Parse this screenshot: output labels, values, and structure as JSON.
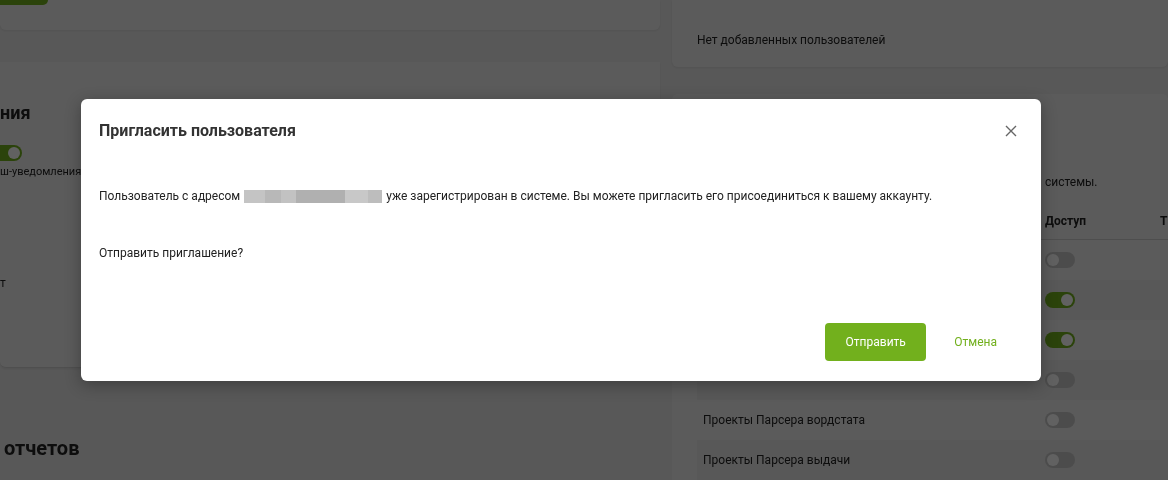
{
  "background": {
    "left_panel": {
      "section_heading": "ния",
      "toggle": {
        "on": true
      },
      "option_label": "ш-уведомления",
      "option_label_2": "т",
      "reports_heading": "отчетов"
    },
    "users_card": {
      "empty_text": "Нет добавленных пользователей"
    },
    "access_card": {
      "description": "системы.",
      "columns": [
        "Доступ",
        "Т"
      ],
      "rows": [
        {
          "on": false
        },
        {
          "on": true
        },
        {
          "on": true
        },
        {
          "on": false
        },
        {
          "label": "Проекты Парсера вордстата",
          "on": false
        },
        {
          "label": "Проекты Парсера выдачи",
          "on": false
        }
      ]
    }
  },
  "dialog": {
    "title": "Пригласить пользователя",
    "message_start": "Пользователь с адресом",
    "message_end": "уже зарегистрирован в системе. Вы можете пригласить его присоединиться к вашему аккаунту.",
    "question": "Отправить приглашение?",
    "buttons": [
      {
        "label": "Отправить",
        "kind": "primary"
      },
      {
        "label": "Отмена",
        "kind": "link"
      }
    ]
  }
}
